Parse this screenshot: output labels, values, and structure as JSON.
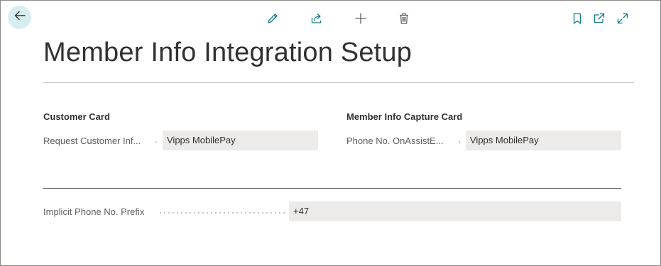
{
  "page": {
    "title": "Member Info Integration Setup"
  },
  "toolbar": {
    "back_icon": "arrow-left-icon",
    "actions": [
      {
        "icon": "pencil-icon",
        "name": "edit"
      },
      {
        "icon": "share-icon",
        "name": "share"
      },
      {
        "icon": "plus-icon",
        "name": "new"
      },
      {
        "icon": "trash-icon",
        "name": "delete"
      }
    ],
    "right_actions": [
      {
        "icon": "bookmark-icon",
        "name": "bookmark"
      },
      {
        "icon": "open-in-new-window-icon",
        "name": "open-new-window"
      },
      {
        "icon": "expand-icon",
        "name": "expand"
      }
    ]
  },
  "groups": {
    "customer_card": {
      "caption": "Customer Card",
      "field_label": "Request Customer Inf...",
      "field_value": "Vipps MobilePay"
    },
    "member_info_capture_card": {
      "caption": "Member Info Capture Card",
      "field_label": "Phone No. OnAssistE...",
      "field_value": "Vipps MobilePay"
    },
    "general": {
      "field_label": "Implicit Phone No. Prefix",
      "field_value": "+47"
    }
  },
  "colors": {
    "accent": "#0f7b84",
    "back_button_bg": "#d7eef0",
    "field_bg": "#edebe9"
  }
}
